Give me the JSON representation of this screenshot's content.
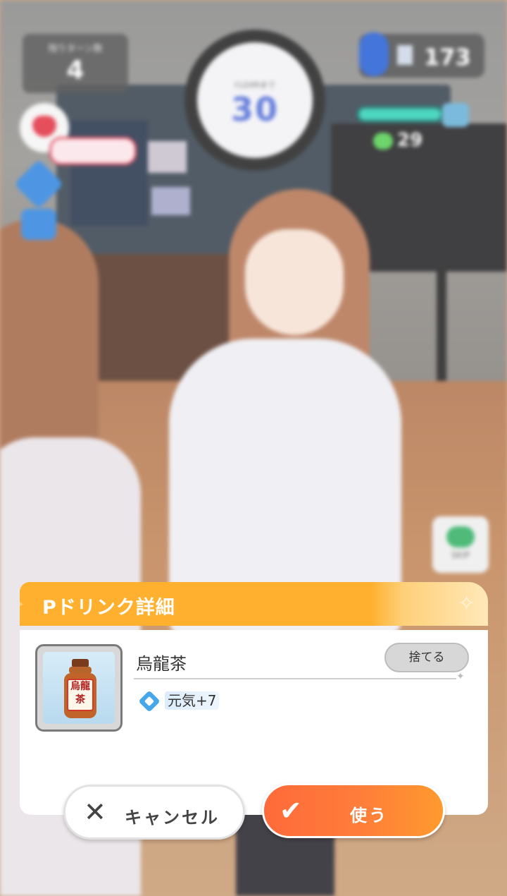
{
  "hud": {
    "turns_label": "残りターン数",
    "turns_value": "4",
    "clear_label": "CLEARまで",
    "clear_value": "30",
    "stamina_value": "173",
    "genki_value": "29",
    "skip_label": "SKIP"
  },
  "dialog": {
    "title": "Pドリンク詳細",
    "item_name": "烏龍茶",
    "bottle_label": "烏龍茶",
    "discard_label": "捨てる",
    "effect_text": "元気+7"
  },
  "buttons": {
    "cancel_label": "キャンセル",
    "use_label": "使う"
  },
  "colors": {
    "header_orange": "#ffb02e",
    "use_button": "#ff7e3a",
    "effect_blue": "#46a6ea"
  }
}
